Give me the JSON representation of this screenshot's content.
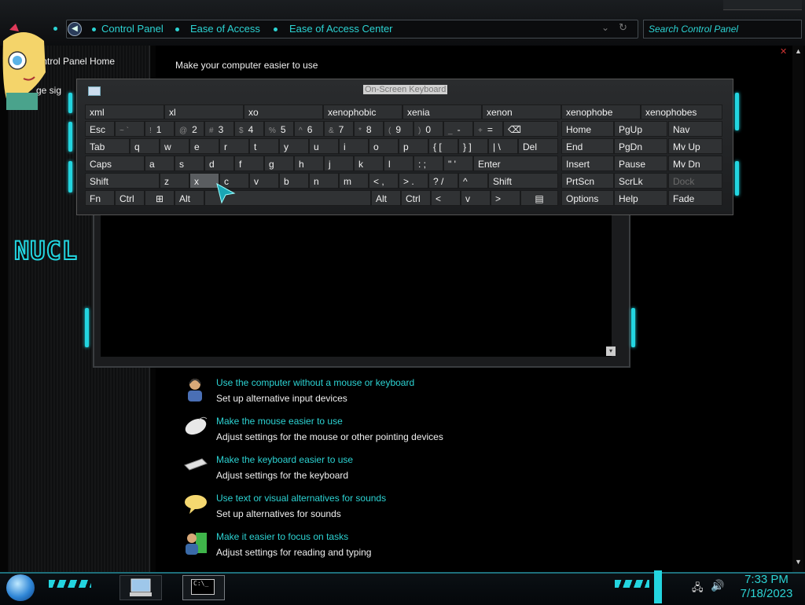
{
  "breadcrumb": {
    "items": [
      "Control Panel",
      "Ease of Access",
      "Ease of Access Center"
    ]
  },
  "search": {
    "placeholder": "Search Control Panel"
  },
  "left_pane": {
    "home_link": "Control Panel Home",
    "change_link_fragment": "ge sig",
    "logo_text": "NUCL"
  },
  "main": {
    "heading": "Make your computer easier to use",
    "tasks": [
      {
        "link": "Use the computer without a mouse or keyboard",
        "desc": "Set up alternative input devices",
        "icon": "user-headset-icon"
      },
      {
        "link": "Make the mouse easier to use",
        "desc": "Adjust settings for the mouse or other pointing devices",
        "icon": "mouse-icon"
      },
      {
        "link": "Make the keyboard easier to use",
        "desc": "Adjust settings for the keyboard",
        "icon": "keyboard-icon"
      },
      {
        "link": "Use text or visual alternatives for sounds",
        "desc": "Set up alternatives for sounds",
        "icon": "speech-bubble-icon"
      },
      {
        "link": "Make it easier to focus on tasks",
        "desc": "Adjust settings for reading and typing",
        "icon": "user-green-icon"
      }
    ]
  },
  "osk": {
    "title": "On-Screen Keyboard",
    "predictions": [
      "xml",
      "xl",
      "xo",
      "xenophobic",
      "xenia",
      "xenon",
      "xenophobe",
      "xenophobes"
    ],
    "row1": [
      {
        "main": "Esc"
      },
      {
        "sub": "~ `",
        "main": ""
      },
      {
        "sub": "!",
        "main": "1"
      },
      {
        "sub": "@",
        "main": "2"
      },
      {
        "sub": "#",
        "main": "3"
      },
      {
        "sub": "$",
        "main": "4"
      },
      {
        "sub": "%",
        "main": "5"
      },
      {
        "sub": "^",
        "main": "6"
      },
      {
        "sub": "&",
        "main": "7"
      },
      {
        "sub": "*",
        "main": "8"
      },
      {
        "sub": "(",
        "main": "9"
      },
      {
        "sub": ")",
        "main": "0"
      },
      {
        "sub": "_",
        "main": "-"
      },
      {
        "sub": "+",
        "main": "="
      },
      {
        "main": "⌫"
      }
    ],
    "row2": [
      "Tab",
      "q",
      "w",
      "e",
      "r",
      "t",
      "y",
      "u",
      "i",
      "o",
      "p",
      "{ [",
      "} ]",
      "| \\",
      "Del"
    ],
    "row3": [
      "Caps",
      "a",
      "s",
      "d",
      "f",
      "g",
      "h",
      "j",
      "k",
      "l",
      ": ;",
      "\" '",
      "Enter"
    ],
    "row4": [
      "Shift",
      "z",
      "x",
      "c",
      "v",
      "b",
      "n",
      "m",
      "< ,",
      "> .",
      "? /",
      "^",
      "Shift"
    ],
    "row5": [
      "Fn",
      "Ctrl",
      "⊞",
      "Alt",
      "",
      "Alt",
      "Ctrl",
      "<",
      "v",
      ">",
      "▤"
    ],
    "nav": [
      [
        "Home",
        "PgUp",
        "Nav"
      ],
      [
        "End",
        "PgDn",
        "Mv Up"
      ],
      [
        "Insert",
        "Pause",
        "Mv Dn"
      ],
      [
        "PrtScn",
        "ScrLk",
        "Dock"
      ],
      [
        "Options",
        "Help",
        "Fade"
      ]
    ]
  },
  "taskbar": {
    "time": "7:33 PM",
    "date": "7/18/2023",
    "cmd_label": "C:\\_"
  },
  "colors": {
    "accent": "#2cd3d3",
    "neon": "#23d5e0"
  }
}
